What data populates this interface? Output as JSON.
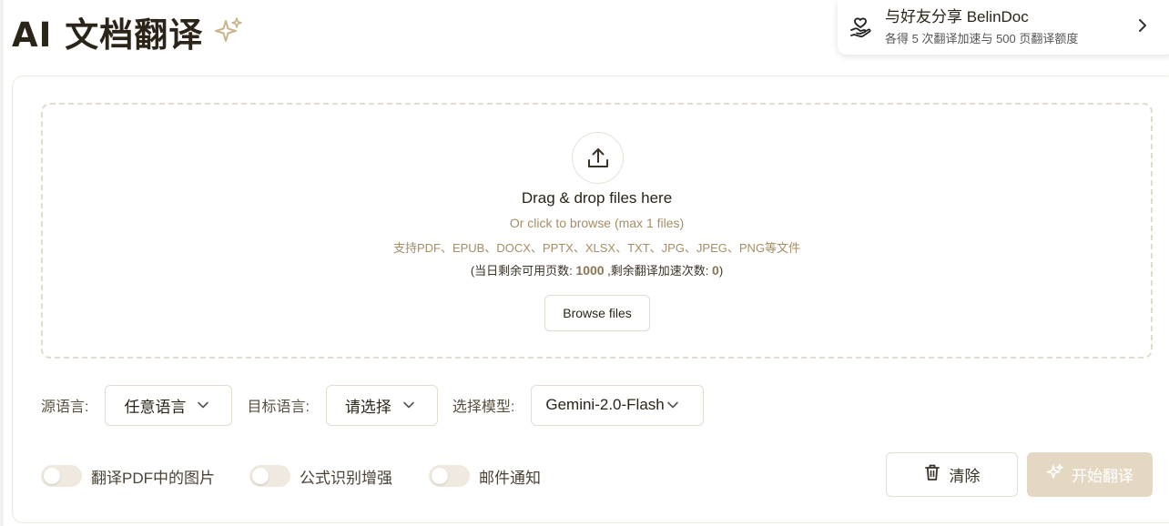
{
  "header": {
    "title": "AI 文档翻译",
    "sparkle_icon": "sparkle-icon"
  },
  "share": {
    "title": "与好友分享 BelinDoc",
    "subtitle": "各得 5 次翻译加速与 500 页翻译额度",
    "icon": "hand-heart-icon",
    "chevron": "›"
  },
  "dropzone": {
    "title": "Drag & drop files here",
    "subtitle": "Or click to browse (max 1 files)",
    "formats": "支持PDF、EPUB、DOCX、PPTX、XLSX、TXT、JPG、JPEG、PNG等文件",
    "quota_prefix": "(当日剩余可用页数: ",
    "quota_pages": "1000",
    "quota_middle": " ,剩余翻译加速次数: ",
    "quota_accel": "0",
    "quota_suffix": ")",
    "browse_label": "Browse files",
    "upload_icon": "upload-icon"
  },
  "settings": {
    "source_label": "源语言:",
    "source_value": "任意语言",
    "target_label": "目标语言:",
    "target_value": "请选择",
    "model_label": "选择模型:",
    "model_value": "Gemini-2.0-Flash"
  },
  "toggles": [
    {
      "label": "翻译PDF中的图片",
      "on": false
    },
    {
      "label": "公式识别增强",
      "on": false
    },
    {
      "label": "邮件通知",
      "on": false
    }
  ],
  "actions": {
    "clear_label": "清除",
    "start_label": "开始翻译"
  },
  "colors": {
    "accent": "#a58d64",
    "start_disabled": "#e5d8c3"
  }
}
